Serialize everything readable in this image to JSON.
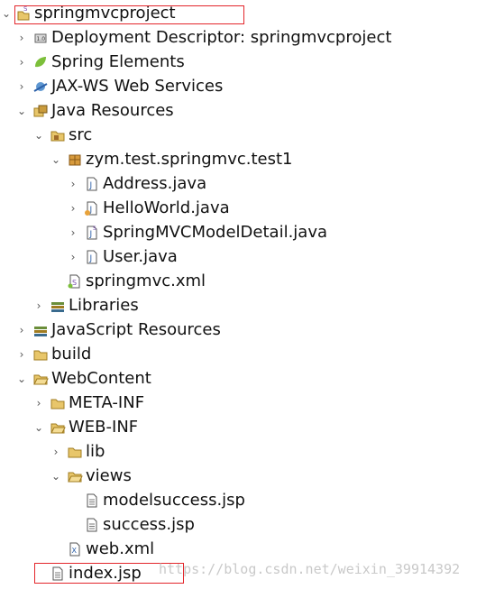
{
  "tree": {
    "project": "springmvcproject",
    "deployment_descriptor": "Deployment Descriptor: springmvcproject",
    "spring_elements": "Spring Elements",
    "jaxws": "JAX-WS Web Services",
    "java_resources": "Java Resources",
    "src": "src",
    "package": "zym.test.springmvc.test1",
    "address": "Address.java",
    "helloworld": "HelloWorld.java",
    "springmvcmodeldetail": "SpringMVCModelDetail.java",
    "user": "User.java",
    "springmvc_xml": "springmvc.xml",
    "libraries": "Libraries",
    "js_resources": "JavaScript Resources",
    "build": "build",
    "webcontent": "WebContent",
    "meta_inf": "META-INF",
    "web_inf": "WEB-INF",
    "lib": "lib",
    "views": "views",
    "modelsuccess": "modelsuccess.jsp",
    "success": "success.jsp",
    "web_xml": "web.xml",
    "index_jsp": "index.jsp"
  },
  "watermark": "https://blog.csdn.net/weixin_39914392",
  "colors": {
    "highlight_box": "#e3262b",
    "folder": "#e8c66a",
    "java_file": "#2b5fa8"
  }
}
